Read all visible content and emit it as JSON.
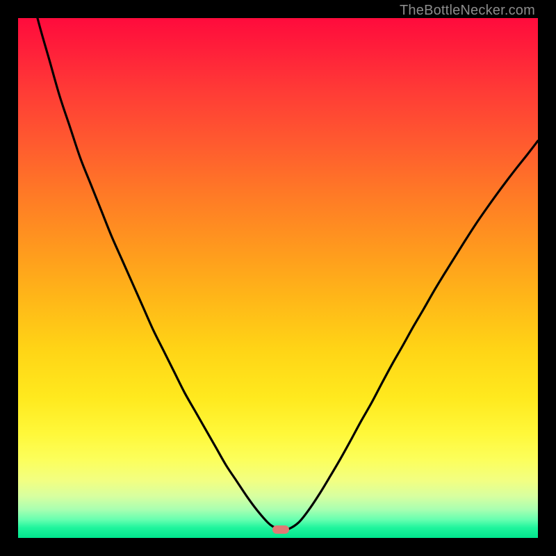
{
  "watermark": {
    "text": "TheBottleNecker.com"
  },
  "chart_data": {
    "type": "line",
    "title": "",
    "xlabel": "",
    "ylabel": "",
    "xlim": [
      0,
      100
    ],
    "ylim": [
      0,
      100
    ],
    "x": [
      0,
      2,
      4,
      6,
      8,
      10,
      12,
      14,
      16,
      18,
      20,
      22,
      24,
      26,
      28,
      30,
      32,
      34,
      36,
      38,
      40,
      42,
      44,
      46,
      48,
      49,
      50,
      51,
      52,
      54,
      56,
      58,
      60,
      62,
      64,
      66,
      68,
      70,
      72,
      74,
      76,
      78,
      80,
      82,
      84,
      86,
      88,
      90,
      92,
      94,
      96,
      98,
      100
    ],
    "y": [
      117,
      107,
      99,
      92,
      85,
      79,
      73,
      68,
      63,
      58,
      53.5,
      49,
      44.5,
      40,
      36,
      32,
      28,
      24.5,
      21,
      17.5,
      14,
      11,
      8,
      5.3,
      3,
      2.2,
      1.8,
      1.7,
      1.7,
      3,
      5.5,
      8.5,
      11.8,
      15.2,
      18.8,
      22.5,
      26,
      29.8,
      33.5,
      37,
      40.6,
      44,
      47.5,
      50.8,
      54,
      57.2,
      60.3,
      63.2,
      66,
      68.7,
      71.3,
      73.8,
      76.4
    ],
    "minimum_marker": {
      "x": 50.5,
      "y": 1.6,
      "color": "#e07a74"
    },
    "gradient_colors": {
      "top": "#ff0b3c",
      "mid": "#ffe91e",
      "bottom": "#00e58e"
    }
  }
}
